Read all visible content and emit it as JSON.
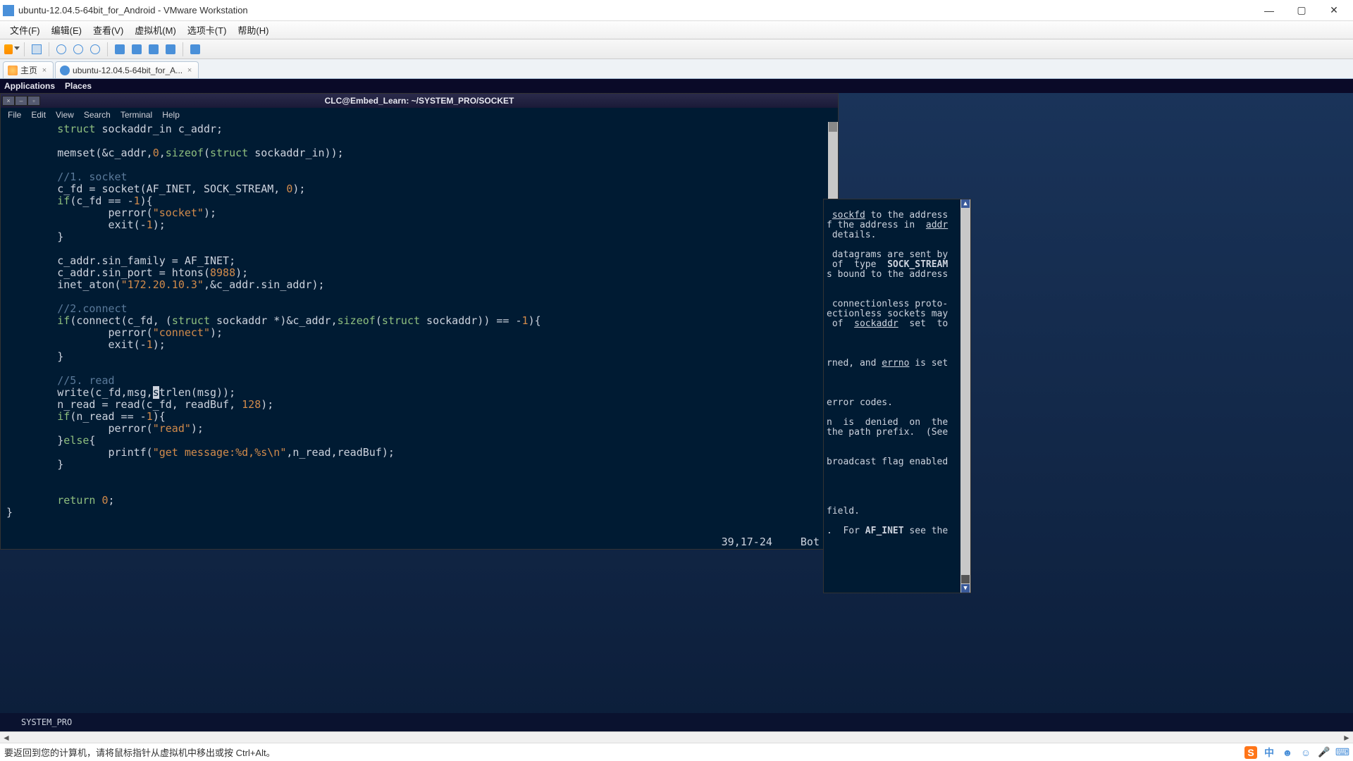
{
  "window": {
    "title": "ubuntu-12.04.5-64bit_for_Android - VMware Workstation"
  },
  "host_menu": {
    "file": "文件(F)",
    "edit": "编辑(E)",
    "view": "查看(V)",
    "vm": "虚拟机(M)",
    "tabs": "选项卡(T)",
    "help": "帮助(H)"
  },
  "tabs": {
    "home": "主页",
    "vm": "ubuntu-12.04.5-64bit_for_A..."
  },
  "gnome": {
    "applications": "Applications",
    "places": "Places"
  },
  "terminal": {
    "title": "CLC@Embed_Learn: ~/SYSTEM_PRO/SOCKET",
    "menu": {
      "file": "File",
      "edit": "Edit",
      "view": "View",
      "search": "Search",
      "terminal": "Terminal",
      "help": "Help"
    },
    "status": {
      "pos": "39,17-24",
      "loc": "Bot"
    }
  },
  "code": {
    "l1a": "struct",
    "l1b": " sockaddr_in c_addr;",
    "l2a": "memset(&c_addr,",
    "l2n0": "0",
    "l2b": ",",
    "l2kw": "sizeof",
    "l2c": "(",
    "l2kw2": "struct",
    "l2d": " sockaddr_in));",
    "c1": "//1. socket",
    "l3a": "c_fd = socket(AF_INET, SOCK_STREAM, ",
    "l3n": "0",
    "l3b": ");",
    "l4a": "if",
    "l4b": "(c_fd == -",
    "l4n": "1",
    "l4c": "){",
    "l5a": "perror(",
    "l5s": "\"socket\"",
    "l5b": ");",
    "l6a": "exit(-",
    "l6n": "1",
    "l6b": ");",
    "l7": "}",
    "l8": "c_addr.sin_family = AF_INET;",
    "l9a": "c_addr.sin_port = htons(",
    "l9n": "8988",
    "l9b": ");",
    "l10a": "inet_aton(",
    "l10s": "\"172.20.10.3\"",
    "l10b": ",&c_addr.sin_addr);",
    "c2": "//2.connect",
    "l11a": "if",
    "l11b": "(connect(c_fd, (",
    "l11kw": "struct",
    "l11c": " sockaddr *)&c_addr,",
    "l11kw2": "sizeof",
    "l11d": "(",
    "l11kw3": "struct",
    "l11e": " sockaddr)) == -",
    "l11n": "1",
    "l11f": "){",
    "l12a": "perror(",
    "l12s": "\"connect\"",
    "l12b": ");",
    "l13a": "exit(-",
    "l13n": "1",
    "l13b": ");",
    "l14": "}",
    "c3": "//5. read",
    "l15a": "write(c_fd,msg,",
    "l15cur": "s",
    "l15b": "trlen(msg));",
    "l16a": "n_read = read(c_fd, readBuf, ",
    "l16n": "128",
    "l16b": ");",
    "l17a": "if",
    "l17b": "(n_read == -",
    "l17n": "1",
    "l17c": "){",
    "l18a": "perror(",
    "l18s": "\"read\"",
    "l18b": ");",
    "l19a": "}",
    "l19kw": "else",
    "l19b": "{",
    "l20a": "printf(",
    "l20s": "\"get message:%d,%s\\n\"",
    "l20b": ",n_read,readBuf);",
    "l21": "}",
    "l22a": "return ",
    "l22n": "0",
    "l22b": ";",
    "l23": "}"
  },
  "man": {
    "l1a": "sockfd",
    "l1b": " to the address",
    "l2a": "f the address in  ",
    "l2b": "addr",
    "l3": " details.",
    "l4": " datagrams are sent by",
    "l5a": " of  type  ",
    "l5b": "SOCK_STREAM",
    "l6": "s bound to the address",
    "l7": " connectionless proto-",
    "l8": "ectionless sockets may",
    "l9a": " of  ",
    "l9b": "sockaddr",
    "l9c": "  set  to",
    "l10a": "rned, and ",
    "l10b": "errno",
    "l10c": " is set",
    "l11": "error codes.",
    "l12": "n  is  denied  on  the",
    "l13": "the path prefix.  (See",
    "l14": "broadcast flag enabled",
    "l15": "field.",
    "l16a": ".  For ",
    "l16b": "AF_INET",
    "l16c": " see the"
  },
  "taskbar": {
    "text": "SYSTEM_PRO"
  },
  "host_hint": "要返回到您的计算机，请将鼠标指针从虚拟机中移出或按 Ctrl+Alt。",
  "tray": {
    "sogou": "S",
    "cn": "中"
  }
}
